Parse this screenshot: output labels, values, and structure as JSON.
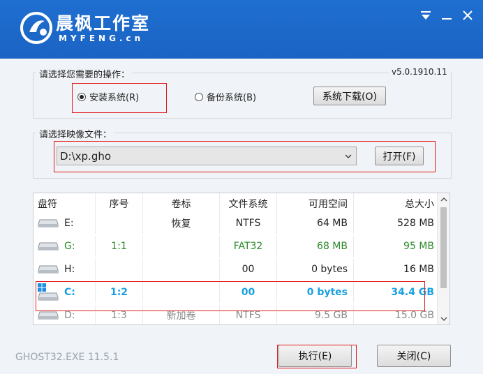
{
  "header": {
    "brand_cn": "晨枫工作室",
    "brand_en": "MYFENG.cn",
    "menu_icon": "menu-icon",
    "minimize_icon": "minimize-icon",
    "close_icon": "close-icon",
    "color": "#1a63c4"
  },
  "operation": {
    "label": "请选择您需要的操作：",
    "version": "v5.0.1910.11",
    "install_label": "安装系统(R)",
    "install_selected": true,
    "backup_label": "备份系统(B)",
    "download_label": "系统下载(O)"
  },
  "image": {
    "label": "请选择映像文件：",
    "path": "D:\\xp.gho",
    "open_label": "打开(F)"
  },
  "table": {
    "headers": [
      "盘符",
      "序号",
      "卷标",
      "文件系统",
      "可用空间",
      "总大小"
    ],
    "rows": [
      {
        "drive": "E:",
        "index": "",
        "volume": "恢复",
        "fs": "NTFS",
        "free": "64 MB",
        "total": "528 MB",
        "color": "#222222",
        "bold": false
      },
      {
        "drive": "G:",
        "index": "1:1",
        "volume": "",
        "fs": "FAT32",
        "free": "68 MB",
        "total": "95 MB",
        "color": "#2b8a2b",
        "bold": false
      },
      {
        "drive": "H:",
        "index": "",
        "volume": "",
        "fs": "00",
        "free": "0 bytes",
        "total": "16 MB",
        "color": "#222222",
        "bold": false
      },
      {
        "drive": "C:",
        "index": "1:2",
        "volume": "",
        "fs": "00",
        "free": "0 bytes",
        "total": "34.4 GB",
        "color": "#1aa0e0",
        "bold": true
      },
      {
        "drive": "D:",
        "index": "1:3",
        "volume": "新加卷",
        "fs": "NTFS",
        "free": "9.5 GB",
        "total": "15.0 GB",
        "color": "#888888",
        "bold": false
      }
    ]
  },
  "footer": {
    "ghost_version": "GHOST32.EXE 11.5.1",
    "execute_label": "执行(E)",
    "close_label": "关闭(C)"
  }
}
